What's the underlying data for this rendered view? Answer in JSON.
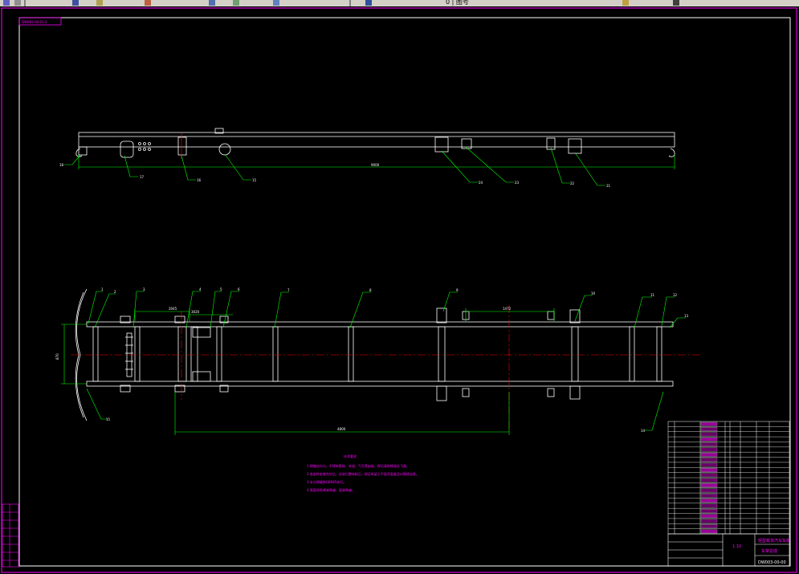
{
  "toolbar": {
    "layer_text": "0 | 图号",
    "icons": [
      "pointer-icon",
      "undo-icon",
      "redo-icon",
      "pan-icon",
      "zoom-icon",
      "properties-icon",
      "layer-icon",
      "color-icon",
      "linetype-icon",
      "help-icon"
    ]
  },
  "drawing": {
    "file_tag": "DW003-00-01.2",
    "elevation_dimension": "9000",
    "plan_dimension_1": "2045",
    "plan_dimension_2": "3020",
    "plan_dimension_long": "4800",
    "plan_dimension_right": "1472",
    "width_dimension": "870",
    "balloons_top": [
      "18",
      "17",
      "16",
      "15",
      "24",
      "23",
      "22",
      "21"
    ],
    "balloons_plan": [
      "1",
      "2",
      "3",
      "4",
      "5",
      "6",
      "7",
      "8",
      "9",
      "10",
      "11",
      "12",
      "13",
      "14",
      "15"
    ],
    "technical_title": "技术要求",
    "technical_notes": [
      "1.焊缝应均匀，不得有裂纹、夹渣、气孔等缺陷，焊后清除焊渣及飞溅。",
      "2.各部件安装完毕后，应进行整体校正，保证纵梁上平面平面度及对角线误差。",
      "3.未注焊缝按GB985执行。",
      "4.表面涂防锈漆两遍，面漆两遍。"
    ]
  },
  "title_block": {
    "drawing_name": "轻型载货汽车车架",
    "drawing_sub": "车架总成",
    "drawing_number": "DW003-00-00",
    "scale": "1:10",
    "part_rows": 22,
    "revision_labels": [
      "标记",
      "处数",
      "分区",
      "更改文件号",
      "签名",
      "年月日"
    ]
  },
  "colors": {
    "frame": "#ffffff",
    "leader": "#00ff00",
    "border": "#ff00ff",
    "centerline": "#ff0000"
  }
}
